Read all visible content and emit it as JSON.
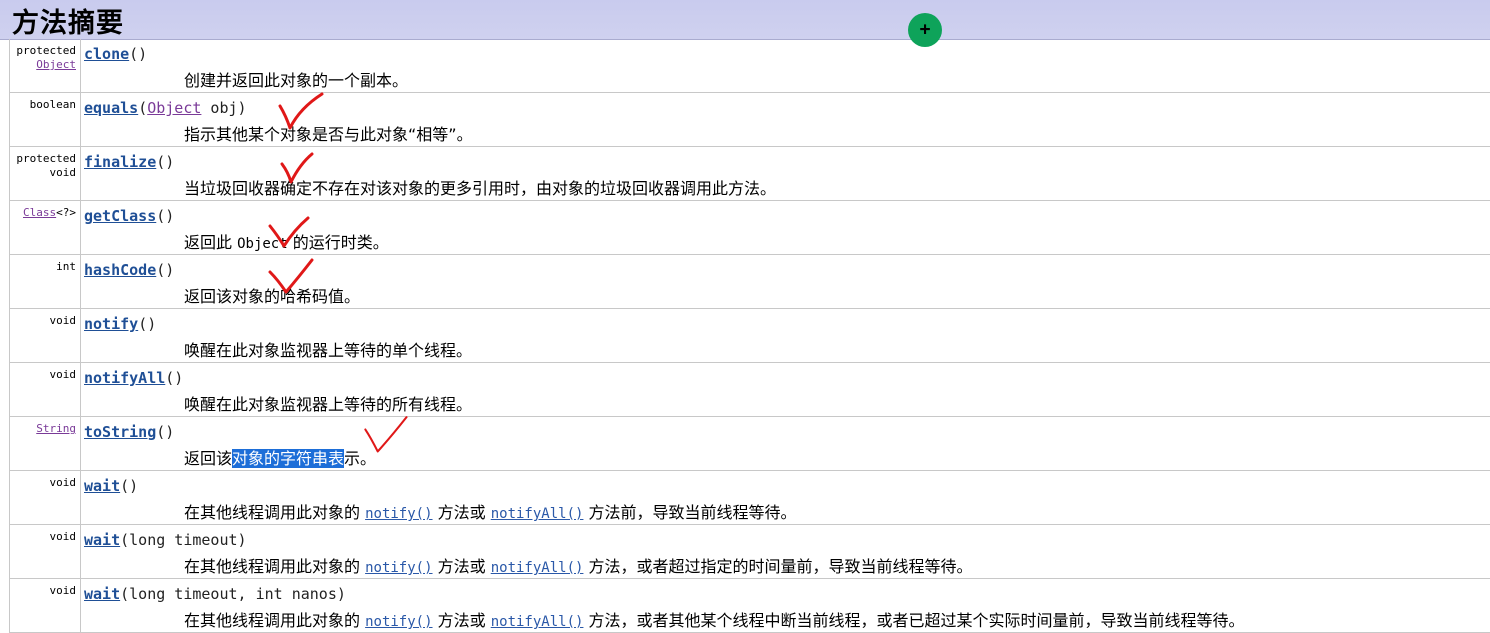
{
  "header": {
    "title": "方法摘要"
  },
  "rows": [
    {
      "type_lines": [
        "protected",
        "Object"
      ],
      "name": "clone",
      "params": "()",
      "desc": "创建并返回此对象的一个副本。"
    },
    {
      "type_lines": [
        "boolean"
      ],
      "name": "equals",
      "param_open": "(",
      "param_link": "Object",
      "param_rest": " obj)",
      "desc": "指示其他某个对象是否与此对象“相等”。"
    },
    {
      "type_lines": [
        "protected",
        "void"
      ],
      "name": "finalize",
      "params": "()",
      "desc": "当垃圾回收器确定不存在对该对象的更多引用时，由对象的垃圾回收器调用此方法。"
    },
    {
      "type_link": "Class",
      "type_rest": "<?>",
      "name": "getClass",
      "params": "()",
      "desc_a": "返回此 ",
      "desc_mono": "Object",
      "desc_b": " 的运行时类。"
    },
    {
      "type_lines": [
        "int"
      ],
      "name": "hashCode",
      "params": "()",
      "desc": "返回该对象的哈希码值。"
    },
    {
      "type_lines": [
        "void"
      ],
      "name": "notify",
      "params": "()",
      "desc": "唤醒在此对象监视器上等待的单个线程。"
    },
    {
      "type_lines": [
        "void"
      ],
      "name": "notifyAll",
      "params": "()",
      "desc": "唤醒在此对象监视器上等待的所有线程。"
    },
    {
      "type_lines": [
        "String"
      ],
      "name": "toString",
      "params": "()",
      "desc_a": "返回该",
      "desc_hl": "对象的字符串表",
      "desc_b": "示。"
    },
    {
      "type_lines": [
        "void"
      ],
      "name": "wait",
      "params": "()",
      "desc_a": "在其他线程调用此对象的 ",
      "link1": "notify()",
      "desc_b": " 方法或 ",
      "link2": "notifyAll()",
      "desc_c": " 方法前，导致当前线程等待。"
    },
    {
      "type_lines": [
        "void"
      ],
      "name": "wait",
      "params": "(long timeout)",
      "desc_a": "在其他线程调用此对象的 ",
      "link1": "notify()",
      "desc_b": " 方法或 ",
      "link2": "notifyAll()",
      "desc_c": " 方法，或者超过指定的时间量前，导致当前线程等待。"
    },
    {
      "type_lines": [
        "void"
      ],
      "name": "wait",
      "params": "(long timeout, int nanos)",
      "desc_a": "在其他线程调用此对象的 ",
      "link1": "notify()",
      "desc_b": " 方法或 ",
      "link2": "notifyAll()",
      "desc_c": " 方法，或者其他某个线程中断当前线程，或者已超过某个实际时间量前，导致当前线程等待。"
    }
  ],
  "colors": {
    "header_bg": "#cfd1ef",
    "method_link": "#1f4f96",
    "type_link": "#7a3a98",
    "check_mark": "#e01818",
    "selection": "#1d6ed8",
    "cursor": "#0ea35a"
  },
  "cursor": {
    "symbol": "+"
  }
}
